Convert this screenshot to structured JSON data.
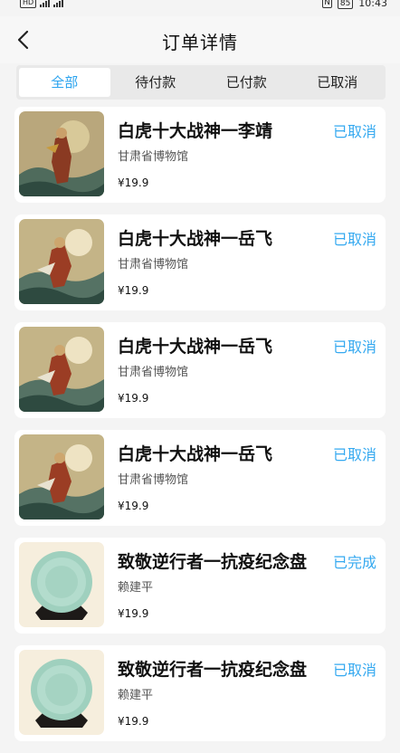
{
  "status_bar": {
    "left_badge": "HD",
    "time": "10:43",
    "battery": "85"
  },
  "header": {
    "back_icon": "chevron-left-icon",
    "title": "订单详情"
  },
  "tabs": [
    {
      "label": "全部",
      "active": true
    },
    {
      "label": "待付款",
      "active": false
    },
    {
      "label": "已付款",
      "active": false
    },
    {
      "label": "已取消",
      "active": false
    }
  ],
  "orders": [
    {
      "name": "白虎十大战神一李靖",
      "venue": "甘肃省博物馆",
      "price": "¥19.9",
      "status": "已取消",
      "image": "warrior-painting"
    },
    {
      "name": "白虎十大战神一岳飞",
      "venue": "甘肃省博物馆",
      "price": "¥19.9",
      "status": "已取消",
      "image": "warrior-painting"
    },
    {
      "name": "白虎十大战神一岳飞",
      "venue": "甘肃省博物馆",
      "price": "¥19.9",
      "status": "已取消",
      "image": "warrior-painting"
    },
    {
      "name": "白虎十大战神一岳飞",
      "venue": "甘肃省博物馆",
      "price": "¥19.9",
      "status": "已取消",
      "image": "warrior-painting"
    },
    {
      "name": "致敬逆行者一抗疫纪念盘",
      "venue": "赖建平",
      "price": "¥19.9",
      "status": "已完成",
      "image": "celadon-plate"
    },
    {
      "name": "致敬逆行者一抗疫纪念盘",
      "venue": "赖建平",
      "price": "¥19.9",
      "status": "已取消",
      "image": "celadon-plate"
    }
  ],
  "colors": {
    "accent": "#2aa3ef",
    "status": "#35a9f0",
    "background": "#f4f4f4"
  }
}
